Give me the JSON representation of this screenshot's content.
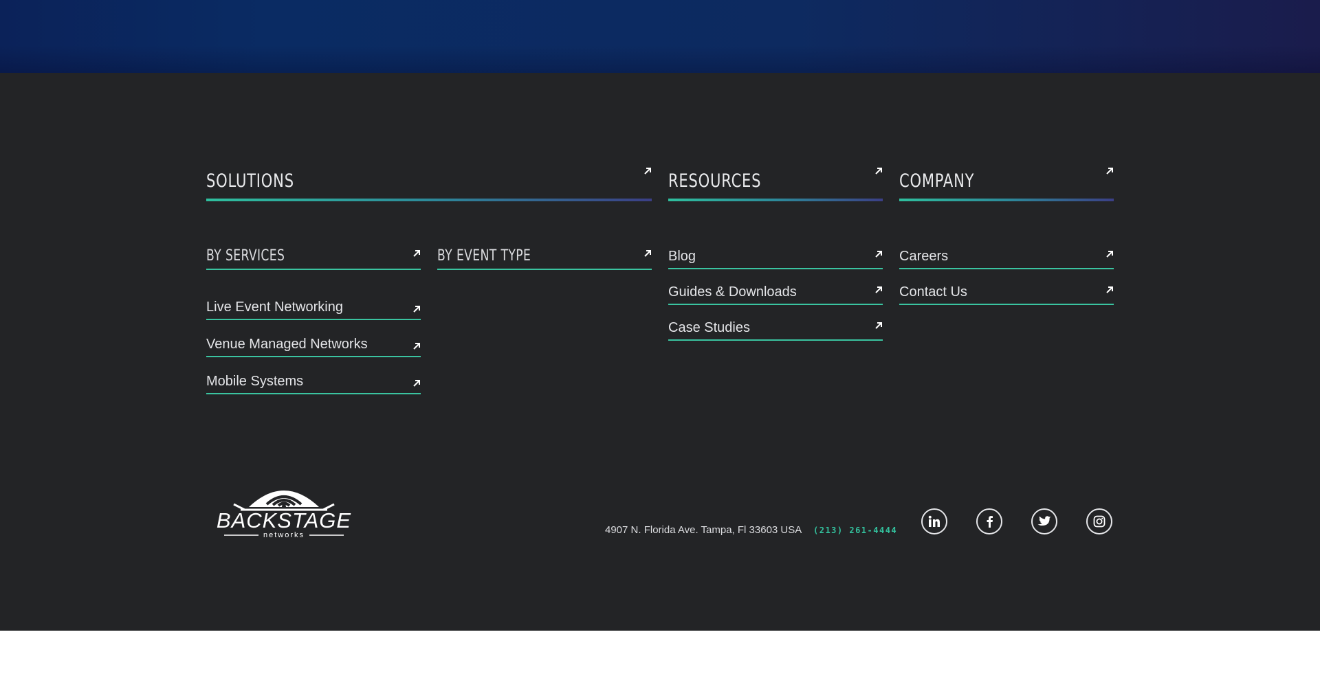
{
  "columns": {
    "solutions": {
      "title": "SOLUTIONS"
    },
    "resources": {
      "title": "RESOURCES"
    },
    "company": {
      "title": "COMPANY"
    }
  },
  "solutions": {
    "by_services": {
      "label": "BY SERVICES",
      "links": [
        "Live Event Networking",
        "Venue Managed Networks",
        "Mobile Systems"
      ]
    },
    "by_event_type": {
      "label": "BY EVENT TYPE"
    }
  },
  "resources": {
    "links": [
      "Blog",
      "Guides & Downloads",
      "Case Studies"
    ]
  },
  "company": {
    "links": [
      "Careers",
      "Contact Us"
    ]
  },
  "footer": {
    "logo_text": "BACKSTAGE",
    "logo_subtext": "networks",
    "address": "4907 N. Florida Ave. Tampa, Fl 33603 USA",
    "phone": "(213) 261-4444",
    "social_icons": [
      "linkedin-icon",
      "facebook-icon",
      "twitter-icon",
      "instagram-icon"
    ]
  },
  "colors": {
    "accent_teal": "#3ac4a0",
    "accent_indigo": "#3b3f86",
    "footer_bg": "#232426",
    "top_band": "#0b2259"
  }
}
